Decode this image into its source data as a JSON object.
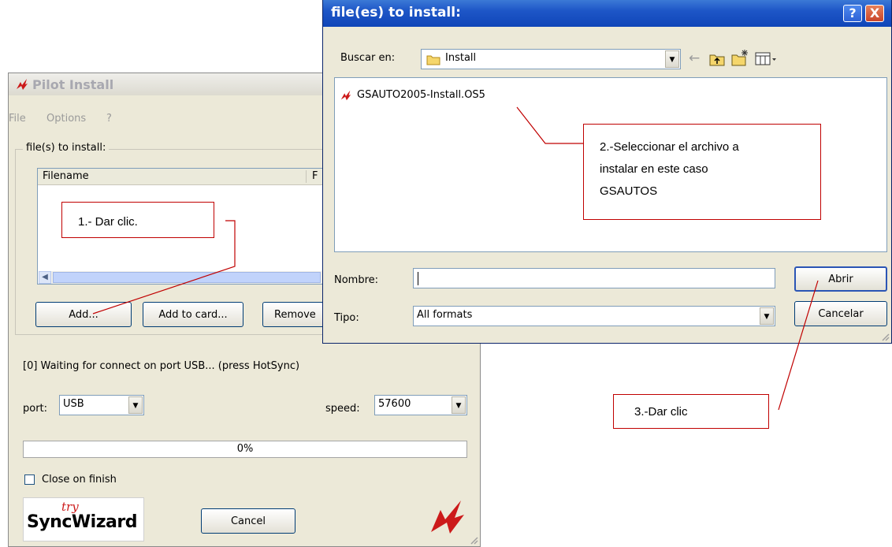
{
  "pilot_window": {
    "title": "Pilot Install",
    "menu": [
      "File",
      "Options",
      "?"
    ],
    "group_label": "file(s) to install:",
    "columns": [
      "Filename",
      "F"
    ],
    "buttons": {
      "add": "Add...",
      "add_card": "Add to card...",
      "remove": "Remove"
    },
    "status": "[0] Waiting for connect on port USB... (press HotSync)",
    "port_label": "port:",
    "port_value": "USB",
    "speed_label": "speed:",
    "speed_value": "57600",
    "progress_text": "0%",
    "progress": 0,
    "close_on_finish_label": "Close on finish",
    "close_on_finish_checked": false,
    "logo_small": "try",
    "logo_text": "SyncWizard",
    "cancel": "Cancel"
  },
  "dialog": {
    "title": "file(es) to install:",
    "look_in_label": "Buscar en:",
    "look_in_value": "Install",
    "files": [
      {
        "name": "GSAUTO2005-Install.OS5",
        "icon": "pilot-logo-icon"
      }
    ],
    "name_label": "Nombre:",
    "name_value": "",
    "type_label": "Tipo:",
    "type_value": "All formats",
    "open_button": "Abrir",
    "cancel_button": "Cancelar",
    "titlebar_buttons": {
      "help": "?",
      "close": "X"
    }
  },
  "annotations": {
    "step1": "1.- Dar clic.",
    "step2_line1": "2.-Seleccionar el archivo a",
    "step2_line2": "instalar en este caso",
    "step2_line3": "GSAUTOS",
    "step3": "3.-Dar clic"
  },
  "colors": {
    "annotation": "#c00000",
    "dialog_title": "#0f45b8",
    "window_bg": "#ece9d8"
  }
}
